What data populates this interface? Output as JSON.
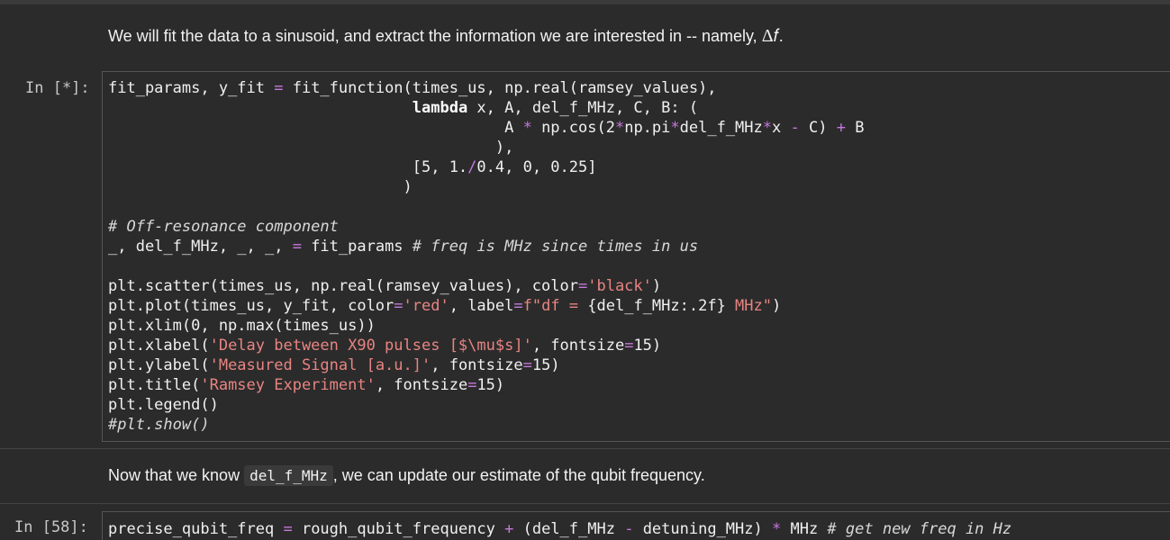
{
  "cells": {
    "md1": {
      "text": "We will fit the data to a sinusoid, and extract the information we are interested in -- namely, ",
      "math": "Δ𝑓",
      "end": "."
    },
    "code1": {
      "prompt": "In [*]:"
    },
    "md2": {
      "before": "Now that we know ",
      "code": "del_f_MHz",
      "after": ", we can update our estimate of the qubit frequency."
    },
    "code2": {
      "prompt": "In [58]:"
    }
  }
}
